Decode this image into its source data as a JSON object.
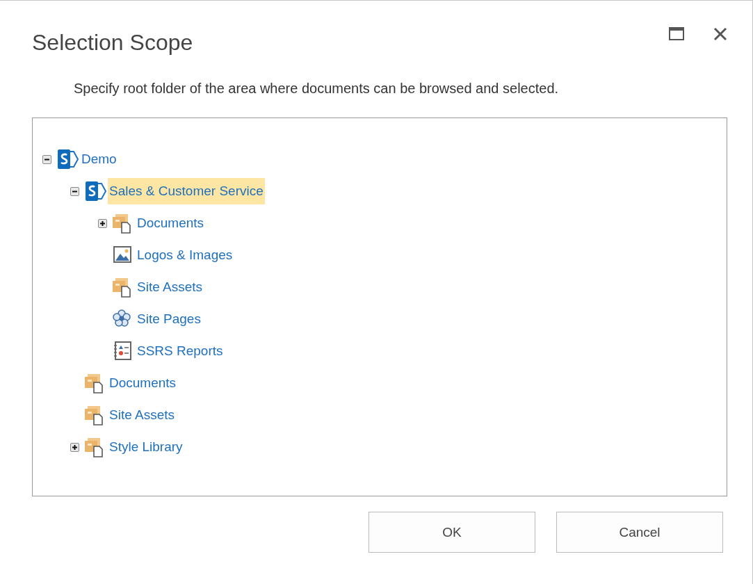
{
  "dialog": {
    "title": "Selection Scope",
    "description": "Specify root folder of the area where documents can be browsed and selected."
  },
  "tree": [
    {
      "label": "Demo",
      "kind": "site",
      "expanded": true,
      "selected": false,
      "children": [
        {
          "label": "Sales & Customer Service",
          "kind": "site",
          "expanded": true,
          "selected": true,
          "children": [
            {
              "label": "Documents",
              "kind": "library",
              "expanded": false,
              "selected": false
            },
            {
              "label": "Logos & Images",
              "kind": "images",
              "selected": false
            },
            {
              "label": "Site Assets",
              "kind": "library",
              "selected": false
            },
            {
              "label": "Site Pages",
              "kind": "pages",
              "selected": false
            },
            {
              "label": "SSRS Reports",
              "kind": "reports",
              "selected": false
            }
          ]
        },
        {
          "label": "Documents",
          "kind": "library",
          "selected": false
        },
        {
          "label": "Site Assets",
          "kind": "library",
          "selected": false
        },
        {
          "label": "Style Library",
          "kind": "library",
          "expanded": false,
          "selected": false
        }
      ]
    }
  ],
  "buttons": [
    "OK",
    "Cancel"
  ]
}
